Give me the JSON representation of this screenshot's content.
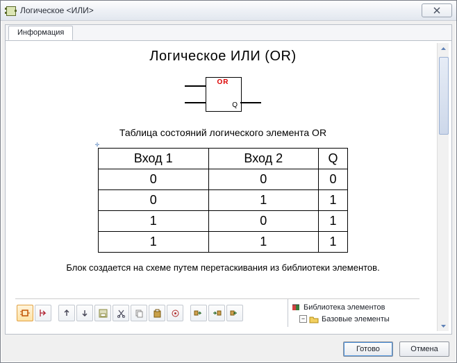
{
  "window": {
    "title": "Логическое <ИЛИ>"
  },
  "tab": {
    "info": "Информация"
  },
  "doc": {
    "title": "Логическое  ИЛИ (OR)",
    "gate_label": "OR",
    "gate_output": "Q",
    "table_caption": "Таблица состояний логического элемента OR",
    "headers": {
      "c1": "Вход 1",
      "c2": "Вход 2",
      "c3": "Q"
    },
    "rows": [
      {
        "a": "0",
        "b": "0",
        "q": "0"
      },
      {
        "a": "0",
        "b": "1",
        "q": "1"
      },
      {
        "a": "1",
        "b": "0",
        "q": "1"
      },
      {
        "a": "1",
        "b": "1",
        "q": "1"
      }
    ],
    "description": "Блок создается на схеме путем перетаскивания из библиотеки элементов."
  },
  "library": {
    "root": "Библиотека элементов",
    "node1": "Базовые элементы"
  },
  "buttons": {
    "ok": "Готово",
    "cancel": "Отмена"
  },
  "chart_data": {
    "type": "table",
    "title": "Таблица состояний логического элемента OR",
    "columns": [
      "Вход 1",
      "Вход 2",
      "Q"
    ],
    "rows": [
      [
        0,
        0,
        0
      ],
      [
        0,
        1,
        1
      ],
      [
        1,
        0,
        1
      ],
      [
        1,
        1,
        1
      ]
    ]
  }
}
